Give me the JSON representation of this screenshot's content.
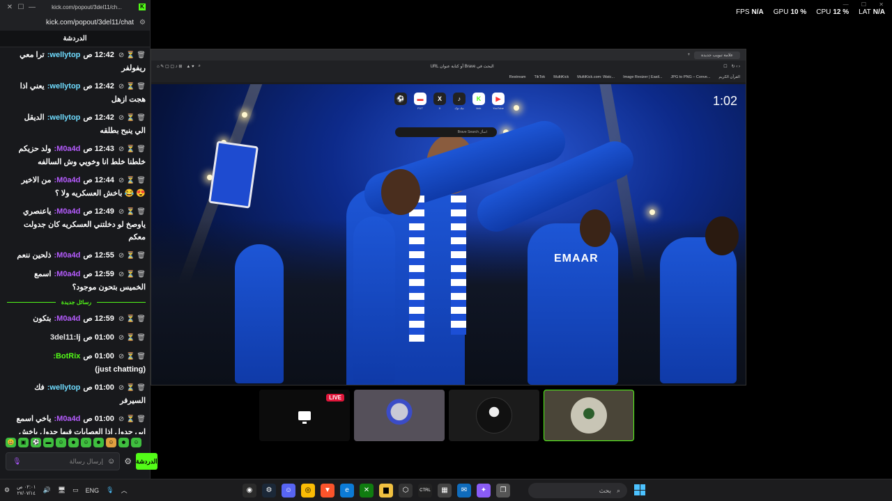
{
  "chat_window": {
    "title_url": "kick.com/popout/3del11/ch...",
    "url": "kick.com/popout/3del11/chat",
    "header": "الدردشة",
    "messages": [
      {
        "time": "12:42 ص",
        "user": "wellytop:",
        "user_color": "#6fdcff",
        "text": "ترا معي",
        "text2": "ريفولفر"
      },
      {
        "time": "12:42 ص",
        "user": "wellytop:",
        "user_color": "#6fdcff",
        "text": "يعني اذا",
        "text2": "هجت ازهل"
      },
      {
        "time": "12:42 ص",
        "user": "wellytop:",
        "user_color": "#6fdcff",
        "text": "الديقل",
        "text2": "الي ينبح بطلقه"
      },
      {
        "time": "12:43 ص",
        "user": "M0a4d:",
        "user_color": "#b65cff",
        "text": "ولد حزيكم",
        "text2": "خلطنا خلط انا وخويي وش السالفه"
      },
      {
        "time": "12:44 ص",
        "user": "M0a4d:",
        "user_color": "#b65cff",
        "text": "من الاخير",
        "text2": "😍 😂 باخش العسكريه ولا ؟"
      },
      {
        "time": "12:49 ص",
        "user": "M0a4d:",
        "user_color": "#b65cff",
        "text": "ياعنصري",
        "text2": "ياوصخ لو دخلتني العسكريه كان جدولت معكم"
      },
      {
        "time": "12:55 ص",
        "user": "M0a4d:",
        "user_color": "#b65cff",
        "text": "ذلحين ننعم",
        "text2": ""
      },
      {
        "time": "12:59 ص",
        "user": "M0a4d:",
        "user_color": "#b65cff",
        "text": "اسمع",
        "text2": "الخميس بتحون موجود؟"
      }
    ],
    "separator_label": "رسائل جديدة",
    "messages_after": [
      {
        "time": "12:59 ص",
        "user": "M0a4d:",
        "user_color": "#b65cff",
        "text": "بتكون",
        "text2": ""
      },
      {
        "time": "01:00 ص",
        "user": "3del11:",
        "user_color": "#e6e6e6",
        "text": "lj",
        "text2": ""
      },
      {
        "time": "01:00 ص",
        "user": "BotRix:",
        "user_color": "#53fc18",
        "text": "",
        "text2": "(just chatting)"
      },
      {
        "time": "01:00 ص",
        "user": "wellytop:",
        "user_color": "#6fdcff",
        "text": "فك",
        "text2": "السيرفر"
      },
      {
        "time": "01:00 ص",
        "user": "M0a4d:",
        "user_color": "#b65cff",
        "text": "ياخي اسمع",
        "text2": "ابي جدول اذا العصابات فيها جدول باخش واذا العسكريه تم قلي وش اكثر"
      }
    ],
    "input_placeholder": "إرسال رسالة",
    "send_label": "الدردشة"
  },
  "hud": {
    "fps_label": "FPS",
    "fps_value": "N/A",
    "gpu_label": "GPU",
    "gpu_value": "10 %",
    "cpu_label": "CPU",
    "cpu_value": "12 %",
    "lat_label": "LAT",
    "lat_value": "N/A"
  },
  "browser": {
    "tab_title": "علامة تبويب جديدة",
    "address": "البحث في Brave أو كتابة عنوان URL",
    "bookmarks": [
      "Restream",
      "TikTok",
      "MultiKick",
      "MultiKick.com: Watc...",
      "Image Resizer | Easil...",
      "JPG to PNG – Conve...",
      "القرآن الكريم"
    ],
    "speed_dial": [
      {
        "label": "",
        "glyph": "⚽",
        "color": "#fff"
      },
      {
        "label": "FUT",
        "glyph": "▬",
        "color": "#e33"
      },
      {
        "label": "X",
        "glyph": "X",
        "color": "#fff"
      },
      {
        "label": "تيك توك",
        "glyph": "♪",
        "color": "#fff"
      },
      {
        "label": "kick",
        "glyph": "K",
        "color": "#53fc18"
      },
      {
        "label": "YouTube",
        "glyph": "▶",
        "color": "#f33"
      }
    ],
    "search_placeholder": "Brave Search اسأل",
    "clock": "1:02",
    "sponsor": "EMAAR"
  },
  "tiles": {
    "live_label": "LIVE"
  },
  "taskbar": {
    "lang": "ENG",
    "time": "٠٢:٠١ ص",
    "date": "٢٧/٠٧/١٤",
    "search_placeholder": "بحث"
  }
}
